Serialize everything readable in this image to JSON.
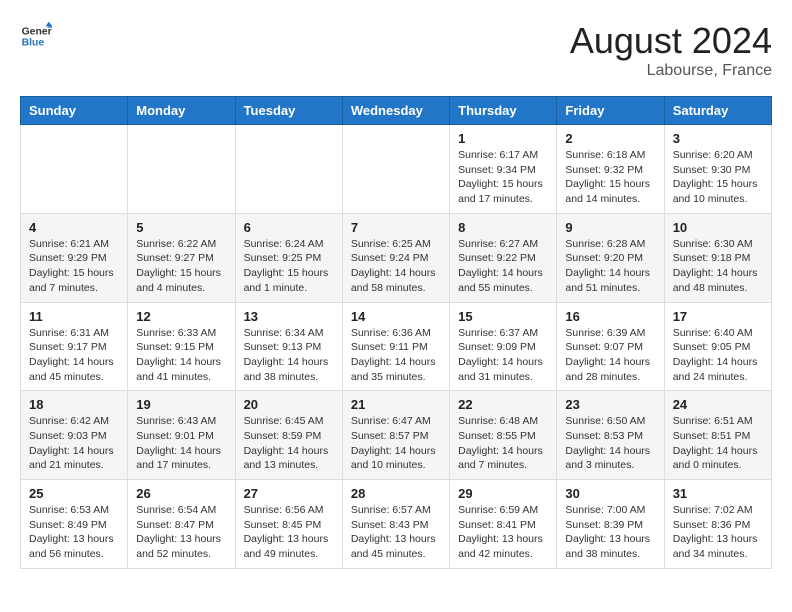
{
  "header": {
    "logo_general": "General",
    "logo_blue": "Blue",
    "month_title": "August 2024",
    "location": "Labourse, France"
  },
  "days_of_week": [
    "Sunday",
    "Monday",
    "Tuesday",
    "Wednesday",
    "Thursday",
    "Friday",
    "Saturday"
  ],
  "weeks": [
    [
      {
        "day": "",
        "info": ""
      },
      {
        "day": "",
        "info": ""
      },
      {
        "day": "",
        "info": ""
      },
      {
        "day": "",
        "info": ""
      },
      {
        "day": "1",
        "info": "Sunrise: 6:17 AM\nSunset: 9:34 PM\nDaylight: 15 hours\nand 17 minutes."
      },
      {
        "day": "2",
        "info": "Sunrise: 6:18 AM\nSunset: 9:32 PM\nDaylight: 15 hours\nand 14 minutes."
      },
      {
        "day": "3",
        "info": "Sunrise: 6:20 AM\nSunset: 9:30 PM\nDaylight: 15 hours\nand 10 minutes."
      }
    ],
    [
      {
        "day": "4",
        "info": "Sunrise: 6:21 AM\nSunset: 9:29 PM\nDaylight: 15 hours\nand 7 minutes."
      },
      {
        "day": "5",
        "info": "Sunrise: 6:22 AM\nSunset: 9:27 PM\nDaylight: 15 hours\nand 4 minutes."
      },
      {
        "day": "6",
        "info": "Sunrise: 6:24 AM\nSunset: 9:25 PM\nDaylight: 15 hours\nand 1 minute."
      },
      {
        "day": "7",
        "info": "Sunrise: 6:25 AM\nSunset: 9:24 PM\nDaylight: 14 hours\nand 58 minutes."
      },
      {
        "day": "8",
        "info": "Sunrise: 6:27 AM\nSunset: 9:22 PM\nDaylight: 14 hours\nand 55 minutes."
      },
      {
        "day": "9",
        "info": "Sunrise: 6:28 AM\nSunset: 9:20 PM\nDaylight: 14 hours\nand 51 minutes."
      },
      {
        "day": "10",
        "info": "Sunrise: 6:30 AM\nSunset: 9:18 PM\nDaylight: 14 hours\nand 48 minutes."
      }
    ],
    [
      {
        "day": "11",
        "info": "Sunrise: 6:31 AM\nSunset: 9:17 PM\nDaylight: 14 hours\nand 45 minutes."
      },
      {
        "day": "12",
        "info": "Sunrise: 6:33 AM\nSunset: 9:15 PM\nDaylight: 14 hours\nand 41 minutes."
      },
      {
        "day": "13",
        "info": "Sunrise: 6:34 AM\nSunset: 9:13 PM\nDaylight: 14 hours\nand 38 minutes."
      },
      {
        "day": "14",
        "info": "Sunrise: 6:36 AM\nSunset: 9:11 PM\nDaylight: 14 hours\nand 35 minutes."
      },
      {
        "day": "15",
        "info": "Sunrise: 6:37 AM\nSunset: 9:09 PM\nDaylight: 14 hours\nand 31 minutes."
      },
      {
        "day": "16",
        "info": "Sunrise: 6:39 AM\nSunset: 9:07 PM\nDaylight: 14 hours\nand 28 minutes."
      },
      {
        "day": "17",
        "info": "Sunrise: 6:40 AM\nSunset: 9:05 PM\nDaylight: 14 hours\nand 24 minutes."
      }
    ],
    [
      {
        "day": "18",
        "info": "Sunrise: 6:42 AM\nSunset: 9:03 PM\nDaylight: 14 hours\nand 21 minutes."
      },
      {
        "day": "19",
        "info": "Sunrise: 6:43 AM\nSunset: 9:01 PM\nDaylight: 14 hours\nand 17 minutes."
      },
      {
        "day": "20",
        "info": "Sunrise: 6:45 AM\nSunset: 8:59 PM\nDaylight: 14 hours\nand 13 minutes."
      },
      {
        "day": "21",
        "info": "Sunrise: 6:47 AM\nSunset: 8:57 PM\nDaylight: 14 hours\nand 10 minutes."
      },
      {
        "day": "22",
        "info": "Sunrise: 6:48 AM\nSunset: 8:55 PM\nDaylight: 14 hours\nand 7 minutes."
      },
      {
        "day": "23",
        "info": "Sunrise: 6:50 AM\nSunset: 8:53 PM\nDaylight: 14 hours\nand 3 minutes."
      },
      {
        "day": "24",
        "info": "Sunrise: 6:51 AM\nSunset: 8:51 PM\nDaylight: 14 hours\nand 0 minutes."
      }
    ],
    [
      {
        "day": "25",
        "info": "Sunrise: 6:53 AM\nSunset: 8:49 PM\nDaylight: 13 hours\nand 56 minutes."
      },
      {
        "day": "26",
        "info": "Sunrise: 6:54 AM\nSunset: 8:47 PM\nDaylight: 13 hours\nand 52 minutes."
      },
      {
        "day": "27",
        "info": "Sunrise: 6:56 AM\nSunset: 8:45 PM\nDaylight: 13 hours\nand 49 minutes."
      },
      {
        "day": "28",
        "info": "Sunrise: 6:57 AM\nSunset: 8:43 PM\nDaylight: 13 hours\nand 45 minutes."
      },
      {
        "day": "29",
        "info": "Sunrise: 6:59 AM\nSunset: 8:41 PM\nDaylight: 13 hours\nand 42 minutes."
      },
      {
        "day": "30",
        "info": "Sunrise: 7:00 AM\nSunset: 8:39 PM\nDaylight: 13 hours\nand 38 minutes."
      },
      {
        "day": "31",
        "info": "Sunrise: 7:02 AM\nSunset: 8:36 PM\nDaylight: 13 hours\nand 34 minutes."
      }
    ]
  ]
}
